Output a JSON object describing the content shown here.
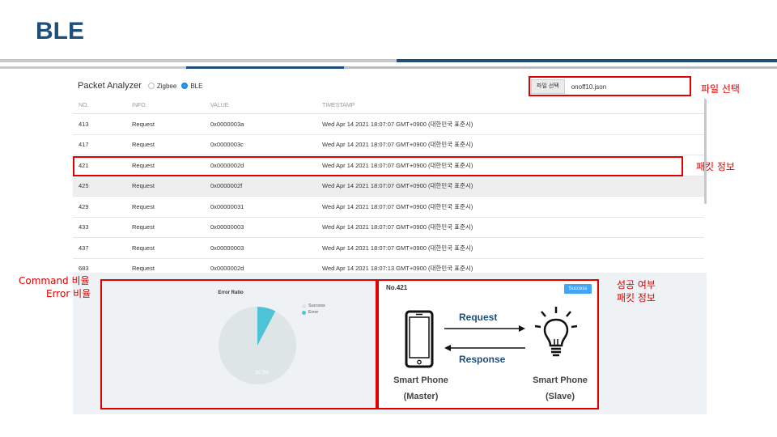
{
  "slide": {
    "title": "BLE"
  },
  "app": {
    "title": "Packet Analyzer",
    "radios": [
      {
        "label": "Zigbee",
        "selected": false
      },
      {
        "label": "BLE",
        "selected": true
      }
    ],
    "file": {
      "button": "파일 선택",
      "name": "onoff10.json"
    }
  },
  "table": {
    "headers": [
      "NO.",
      "INFO",
      "VALUE",
      "TIMESTAMP"
    ],
    "rows": [
      {
        "no": "413",
        "info": "Request",
        "value": "0x0000003a",
        "ts": "Wed Apr 14 2021 18:07:07 GMT+0900 (대한민국 표준시)"
      },
      {
        "no": "417",
        "info": "Request",
        "value": "0x0000003c",
        "ts": "Wed Apr 14 2021 18:07:07 GMT+0900 (대한민국 표준시)"
      },
      {
        "no": "421",
        "info": "Request",
        "value": "0x0000002d",
        "ts": "Wed Apr 14 2021 18:07:07 GMT+0900 (대한민국 표준시)"
      },
      {
        "no": "425",
        "info": "Request",
        "value": "0x0000002f",
        "ts": "Wed Apr 14 2021 18:07:07 GMT+0900 (대한민국 표준시)"
      },
      {
        "no": "429",
        "info": "Request",
        "value": "0x00000031",
        "ts": "Wed Apr 14 2021 18:07:07 GMT+0900 (대한민국 표준시)"
      },
      {
        "no": "433",
        "info": "Request",
        "value": "0x00000003",
        "ts": "Wed Apr 14 2021 18:07:07 GMT+0900 (대한민국 표준시)"
      },
      {
        "no": "437",
        "info": "Request",
        "value": "0x00000003",
        "ts": "Wed Apr 14 2021 18:07:07 GMT+0900 (대한민국 표준시)"
      },
      {
        "no": "683",
        "info": "Request",
        "value": "0x0000002d",
        "ts": "Wed Apr 14 2021 18:07:13 GMT+0900 (대한민국 표준시)"
      }
    ],
    "highlighted_row": 3
  },
  "chart_data": {
    "type": "pie",
    "title": "Error Ratio",
    "labels": [
      "Success",
      "Error"
    ],
    "values": [
      92.3,
      7.7
    ],
    "data_label": "92.3%",
    "colors": [
      "#dde5e7",
      "#4fc3d6"
    ],
    "legend": "top-right"
  },
  "detail": {
    "packet_no": "No.421",
    "status": "Success",
    "request_label": "Request",
    "response_label": "Response",
    "master": {
      "name": "Smart Phone",
      "role": "(Master)"
    },
    "slave": {
      "name": "Smart Phone",
      "role": "(Slave)"
    }
  },
  "annotations": {
    "file_select": "파일 선택",
    "packet_info": "패킷 정보",
    "command_ratio": "Command 비율",
    "error_ratio": "Error 비율",
    "success_status": "성공 여부",
    "packet_info2": "패킷 정보"
  },
  "colors": {
    "brand": "#1f4e79",
    "annotation": "#e00000",
    "accent": "#42a5f5"
  }
}
